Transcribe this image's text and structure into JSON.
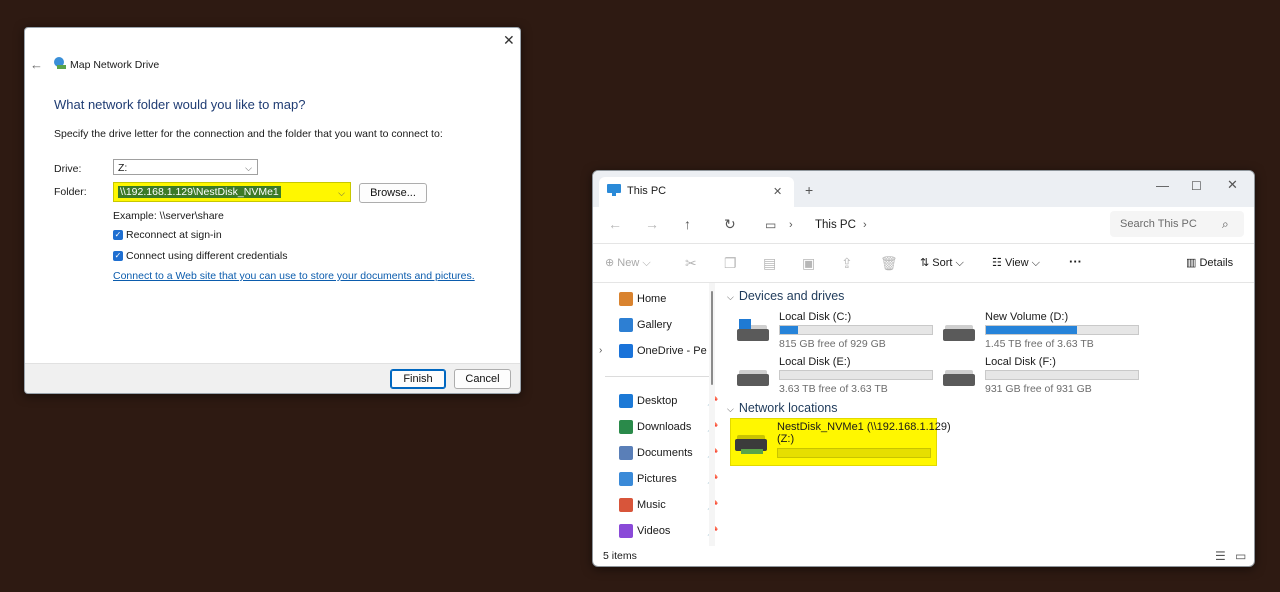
{
  "dialog": {
    "title": "Map Network Drive",
    "heading": "What network folder would you like to map?",
    "instruction": "Specify the drive letter for the connection and the folder that you want to connect to:",
    "drive_label": "Drive:",
    "drive_value": "Z:",
    "folder_label": "Folder:",
    "folder_value": "\\\\192.168.1.129\\NestDisk_NVMe1",
    "browse_label": "Browse...",
    "example": "Example: \\\\server\\share",
    "reconnect_label": "Reconnect at sign-in",
    "reconnect_checked": true,
    "credentials_label": "Connect using different credentials",
    "credentials_checked": true,
    "link_text": "Connect to a Web site that you can use to store your documents and pictures.",
    "finish_label": "Finish",
    "cancel_label": "Cancel"
  },
  "explorer": {
    "tab_title": "This PC",
    "breadcrumb": "This PC",
    "search_placeholder": "Search This PC",
    "toolbar": {
      "new_label": "New",
      "sort_label": "Sort",
      "view_label": "View",
      "more_label": "···",
      "details_label": "Details"
    },
    "sidebar": {
      "top": [
        {
          "label": "Home",
          "color": "#d9832f"
        },
        {
          "label": "Gallery",
          "color": "#2d7fd3"
        },
        {
          "label": "OneDrive - Perso",
          "color": "#1a73d9"
        }
      ],
      "pinned": [
        {
          "label": "Desktop",
          "color": "#1c79d6"
        },
        {
          "label": "Downloads",
          "color": "#2a8a4a"
        },
        {
          "label": "Documents",
          "color": "#5a7fb8"
        },
        {
          "label": "Pictures",
          "color": "#3a8ad8"
        },
        {
          "label": "Music",
          "color": "#d8553a"
        },
        {
          "label": "Videos",
          "color": "#8a4ad8"
        }
      ]
    },
    "sections": {
      "devices_title": "Devices and drives",
      "network_title": "Network locations"
    },
    "drives": [
      {
        "name": "Local Disk (C:)",
        "free": "815 GB free of 929 GB",
        "used_fraction": 0.12
      },
      {
        "name": "New Volume (D:)",
        "free": "1.45 TB free of 3.63 TB",
        "used_fraction": 0.6
      },
      {
        "name": "Local Disk (E:)",
        "free": "3.63 TB free of 3.63 TB",
        "used_fraction": 0.0
      },
      {
        "name": "Local Disk (F:)",
        "free": "931 GB free of 931 GB",
        "used_fraction": 0.0
      }
    ],
    "network": [
      {
        "name": "NestDisk_NVMe1 (\\\\192.168.1.129)",
        "letter": "(Z:)",
        "used_fraction": 0.0
      }
    ],
    "status": "5 items",
    "highlight_color": "#fff700"
  }
}
